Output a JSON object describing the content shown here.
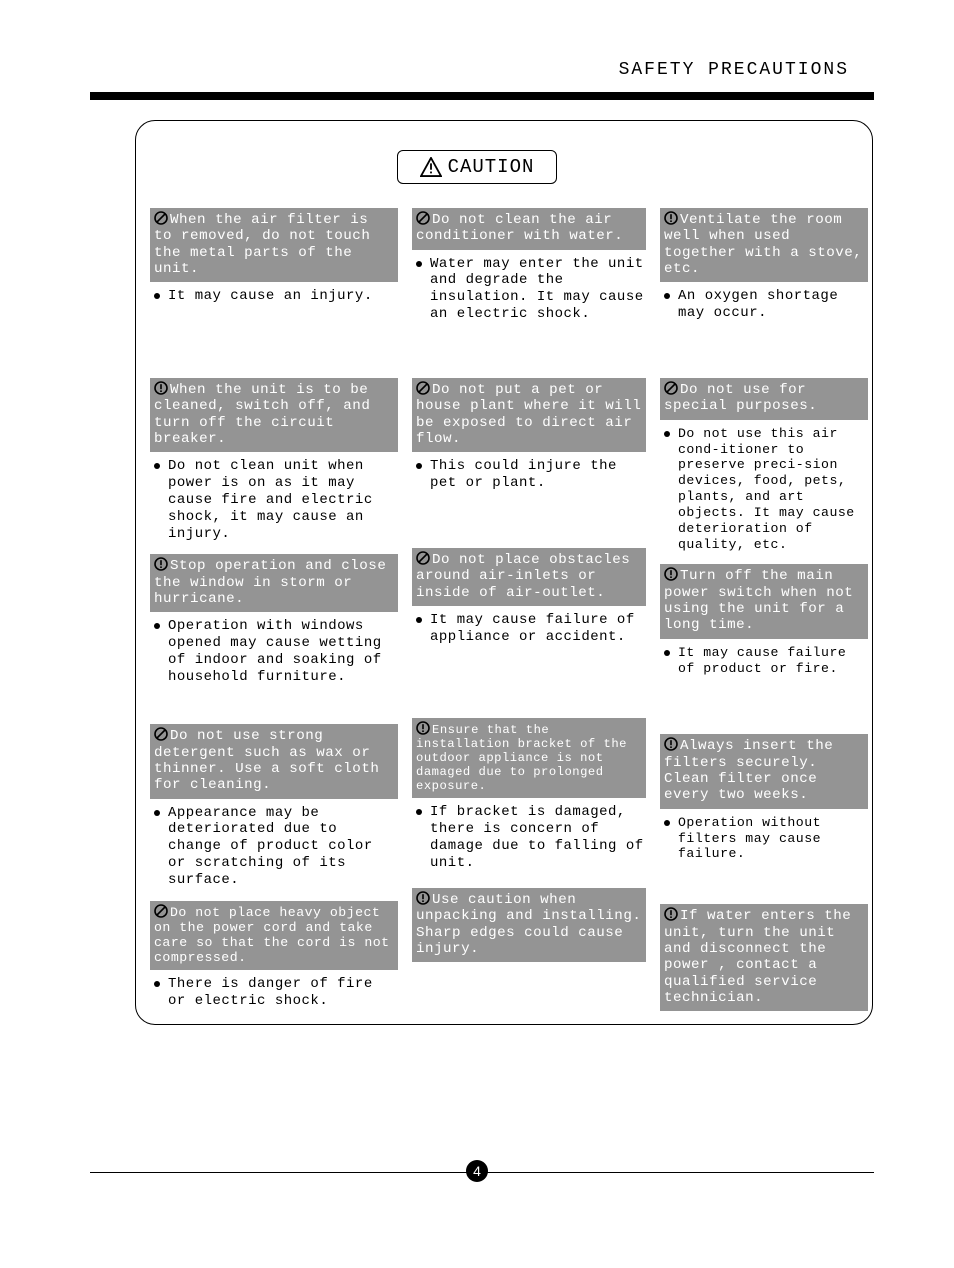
{
  "header": {
    "title": "SAFETY PRECAUTIONS"
  },
  "caution_label": "CAUTION",
  "page_number": "4",
  "icon": {
    "prohibit": "prohibit",
    "mandatory": "mandatory"
  },
  "col1": [
    {
      "icon": "prohibit",
      "heading": "When the air filter is to removed, do not touch the metal parts of the unit.",
      "detail": "It may cause an injury."
    },
    {
      "icon": "mandatory",
      "heading": "When the unit is to be cleaned, switch off, and turn off the circuit breaker.",
      "detail": "Do not clean unit when power is on as it may cause fire and electric shock, it may cause an injury."
    },
    {
      "icon": "mandatory",
      "heading": "Stop operation and close the window in storm or hurricane.",
      "detail": "Operation with windows opened may cause wetting of indoor and soaking of household furniture."
    },
    {
      "icon": "prohibit",
      "heading": "Do not use strong detergent such as wax or thinner. Use a soft cloth for cleaning.",
      "detail": "Appearance may be deteriorated due to change of product color or scratching of its surface."
    },
    {
      "icon": "prohibit",
      "heading": "Do not place heavy object on the power cord and take care so that the cord is not compressed.",
      "detail": "There is danger of fire or electric shock."
    }
  ],
  "col2": [
    {
      "icon": "prohibit",
      "heading": "Do not clean the air conditioner with water.",
      "detail": "Water may enter the unit and degrade the insulation. It may cause an electric shock."
    },
    {
      "icon": "prohibit",
      "heading": "Do not put a pet or house plant where it will be exposed to direct air flow.",
      "detail": "This could injure the pet or plant."
    },
    {
      "icon": "prohibit",
      "heading": "Do not place obstacles around air-inlets or inside of air-outlet.",
      "detail": "It may cause failure of appliance or accident."
    },
    {
      "icon": "mandatory",
      "heading": "Ensure that the installation bracket of the outdoor appliance is not damaged due to prolonged exposure.",
      "detail": "If bracket is damaged, there is concern of damage due to falling of unit."
    },
    {
      "icon": "mandatory",
      "heading": "Use caution when unpacking and installing. Sharp edges could cause injury.",
      "detail": ""
    }
  ],
  "col3": [
    {
      "icon": "mandatory",
      "heading": "Ventilate the room well when used together with a stove, etc.",
      "detail": "An oxygen shortage may occur."
    },
    {
      "icon": "prohibit",
      "heading": "Do not use for special purposes.",
      "detail": "Do not use this air cond-itioner to preserve preci-sion devices, food, pets, plants, and art objects. It may cause deterioration of quality, etc."
    },
    {
      "icon": "mandatory",
      "heading": "Turn off the main power switch when not using the unit for a long time.",
      "detail": "It may cause failure of product or fire."
    },
    {
      "icon": "mandatory",
      "heading": "Always insert the filters securely. Clean filter once every two weeks.",
      "detail": "Operation without filters may cause failure."
    },
    {
      "icon": "mandatory",
      "heading": "If water enters the unit, turn the unit and disconnect the power , contact a qualified service technician.",
      "detail": ""
    }
  ]
}
